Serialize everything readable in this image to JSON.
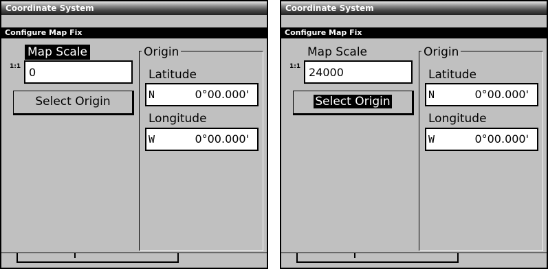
{
  "screens": [
    {
      "title": "Coordinate System",
      "subtitle": "Configure Map Fix",
      "map_scale_label": "Map Scale",
      "map_scale_label_selected": true,
      "ratio_label": "1:1",
      "map_scale_value": "0",
      "select_origin_label": "Select Origin",
      "select_origin_selected": false,
      "origin_legend": "Origin",
      "latitude_label": "Latitude",
      "latitude_hemisphere": "N",
      "latitude_value": "0°00.000'",
      "longitude_label": "Longitude",
      "longitude_hemisphere": "W",
      "longitude_value": "0°00.000'"
    },
    {
      "title": "Coordinate System",
      "subtitle": "Configure Map Fix",
      "map_scale_label": "Map Scale",
      "map_scale_label_selected": false,
      "ratio_label": "1:1",
      "map_scale_value": "24000",
      "select_origin_label": "Select Origin",
      "select_origin_selected": true,
      "origin_legend": "Origin",
      "latitude_label": "Latitude",
      "latitude_hemisphere": "N",
      "latitude_value": "0°00.000'",
      "longitude_label": "Longitude",
      "longitude_hemisphere": "W",
      "longitude_value": "0°00.000'"
    }
  ]
}
